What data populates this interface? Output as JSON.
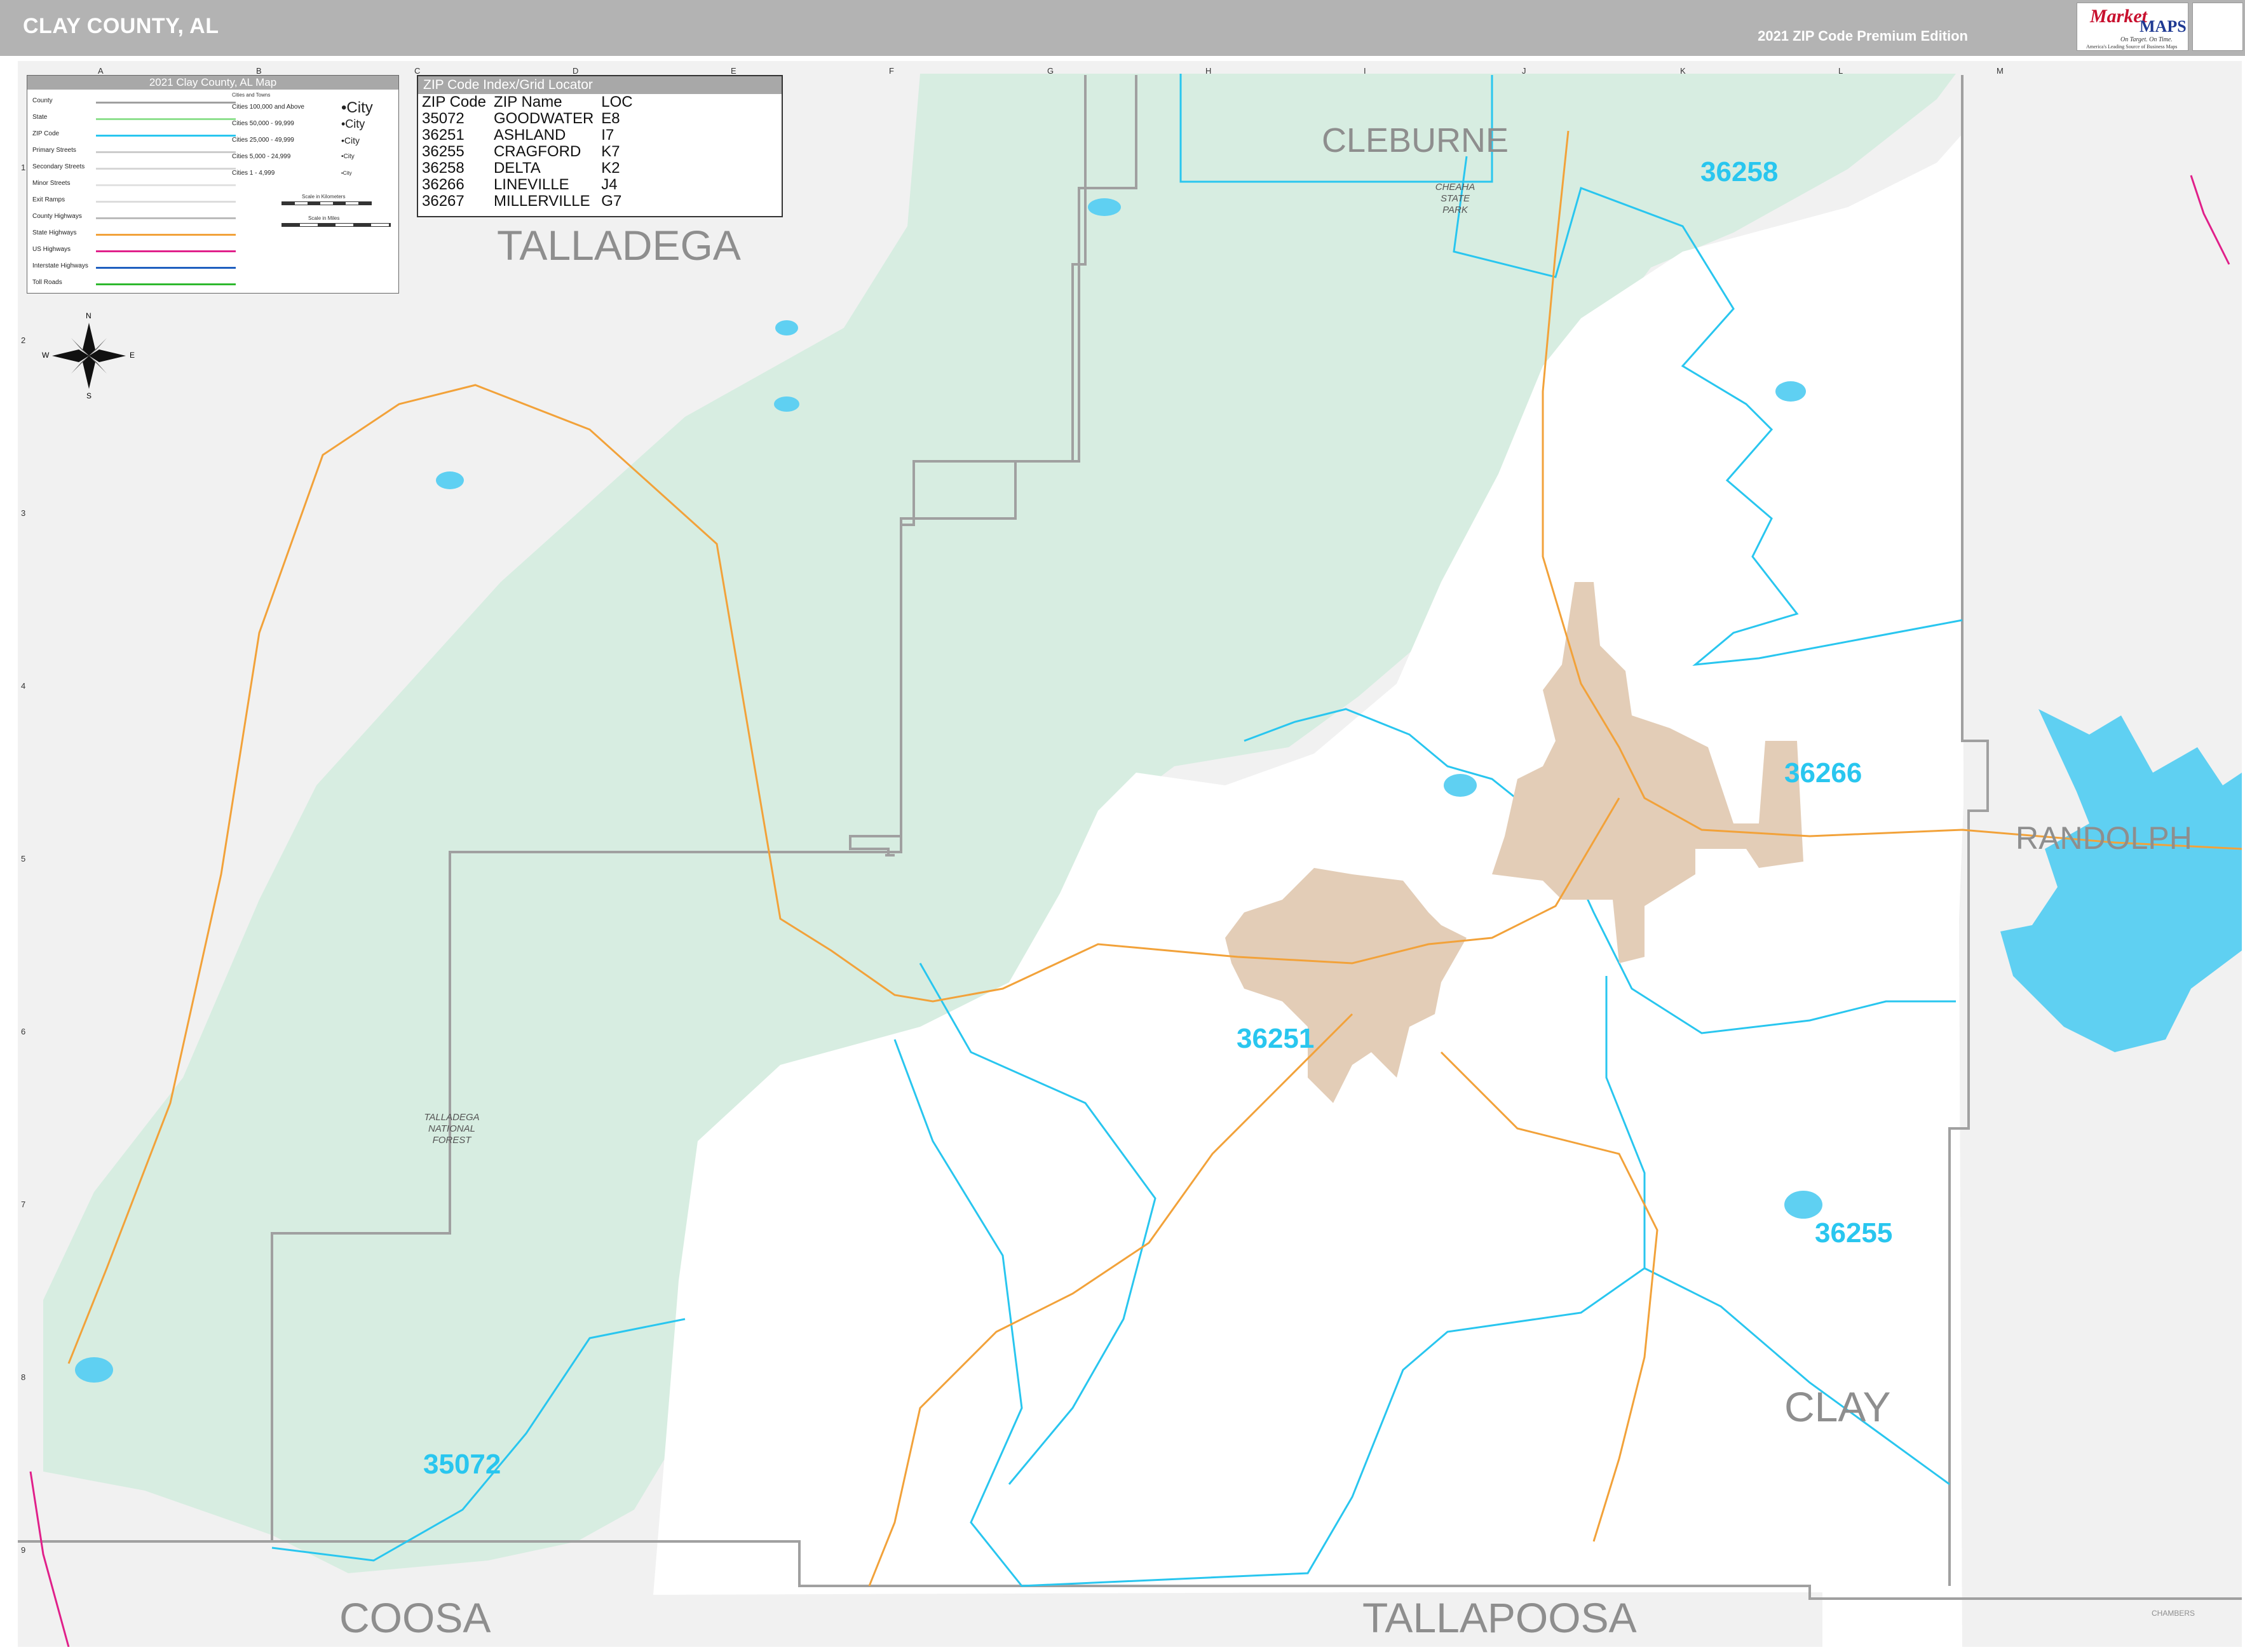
{
  "header": {
    "title": "CLAY COUNTY, AL",
    "edition": "2021 ZIP Code Premium Edition"
  },
  "logo": {
    "brand_top": "Market",
    "brand_bottom": "MAPS",
    "tagline": "On Target. On Time.",
    "subtitle": "America's Leading Source of Business Maps"
  },
  "legend": {
    "title": "2021 Clay County, AL Map",
    "rows": [
      {
        "label": "County",
        "color": "#a0a0a0"
      },
      {
        "label": "State",
        "color": "#8fe08f"
      },
      {
        "label": "ZIP Code",
        "color": "#29c6ef"
      },
      {
        "label": "Primary Streets",
        "color": "#cccccc"
      },
      {
        "label": "Secondary Streets",
        "color": "#d6d6d6"
      },
      {
        "label": "Minor Streets",
        "color": "#e2e2e2"
      },
      {
        "label": "Exit Ramps",
        "color": "#dddddd"
      },
      {
        "label": "County Highways",
        "color": "#bbbbbb"
      },
      {
        "label": "State Highways",
        "color": "#f2a23a"
      },
      {
        "label": "US Highways",
        "color": "#e0208a"
      },
      {
        "label": "Interstate Highways",
        "color": "#1f5fbf"
      },
      {
        "label": "Toll Roads",
        "color": "#2eb82e"
      }
    ],
    "cities_header": "Cities and Towns",
    "city_sizes": [
      {
        "label": "Cities 100,000 and Above",
        "example": "City"
      },
      {
        "label": "Cities 50,000 - 99,999",
        "example": "City"
      },
      {
        "label": "Cities 25,000 - 49,999",
        "example": "City"
      },
      {
        "label": "Cities 5,000 - 24,999",
        "example": "City"
      },
      {
        "label": "Cities 1 - 4,999",
        "example": "City"
      }
    ],
    "scale_km": "Scale in Kilometers",
    "scale_mi": "Scale in Miles"
  },
  "zip_index": {
    "title": "ZIP Code Index/Grid Locator",
    "columns": [
      "ZIP Code",
      "ZIP Name",
      "LOC"
    ],
    "rows": [
      [
        "35072",
        "GOODWATER",
        "E8"
      ],
      [
        "36251",
        "ASHLAND",
        "I7"
      ],
      [
        "36255",
        "CRAGFORD",
        "K7"
      ],
      [
        "36258",
        "DELTA",
        "K2"
      ],
      [
        "36266",
        "LINEVILLE",
        "J4"
      ],
      [
        "36267",
        "MILLERVILLE",
        "G7"
      ]
    ]
  },
  "grid": {
    "letters": [
      "A",
      "B",
      "C",
      "D",
      "E",
      "F",
      "G",
      "H",
      "I",
      "J",
      "K",
      "L",
      "M"
    ],
    "numbers": [
      "1",
      "2",
      "3",
      "4",
      "5",
      "6",
      "7",
      "8",
      "9"
    ]
  },
  "compass": {
    "n": "N",
    "s": "S",
    "e": "E",
    "w": "W"
  },
  "counties": {
    "talladega": "TALLADEGA",
    "cleburne": "CLEBURNE",
    "randolph": "RANDOLPH",
    "clay": "CLAY",
    "coosa": "COOSA",
    "tallapoosa": "TALLAPOOSA",
    "chambers": "CHAMBERS"
  },
  "zips": {
    "z36258": "36258",
    "z36266": "36266",
    "z36251": "36251",
    "z36255": "36255",
    "z35072": "35072"
  },
  "places": {
    "forest": "TALLADEGA NATIONAL FOREST",
    "park": "CHEAHA STATE PARK"
  },
  "colors": {
    "forest": "#d7ede1",
    "outside": "#f1f1f1",
    "zip_line": "#29c6ef",
    "water": "#5fd0f2",
    "urban": "#e3cdb7",
    "county_line": "#a0a0a0",
    "state_highway": "#f2a23a"
  }
}
